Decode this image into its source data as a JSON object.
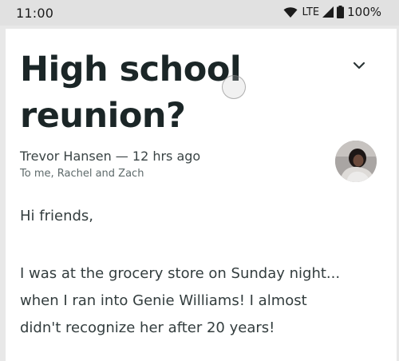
{
  "status_bar": {
    "time": "11:00",
    "network": "LTE",
    "battery": "100%"
  },
  "email": {
    "subject": "High school reunion?",
    "sender": "Trevor Hansen",
    "time_ago": "12 hrs ago",
    "sender_line": "Trevor Hansen — 12 hrs ago",
    "recipients": "To me, Rachel and Zach",
    "greeting": "Hi friends,",
    "body": "I was at the grocery store on Sunday night...\nwhen I ran into Genie Williams! I almost\ndidn't recognize her after 20 years!"
  },
  "icons": {
    "expand": "chevron-down-icon",
    "wifi": "wifi-icon",
    "signal": "signal-icon",
    "battery": "battery-icon"
  },
  "colors": {
    "status_bar_bg": "#e1e1e1",
    "card_bg": "#ffffff",
    "subject_text": "#1b2627"
  }
}
